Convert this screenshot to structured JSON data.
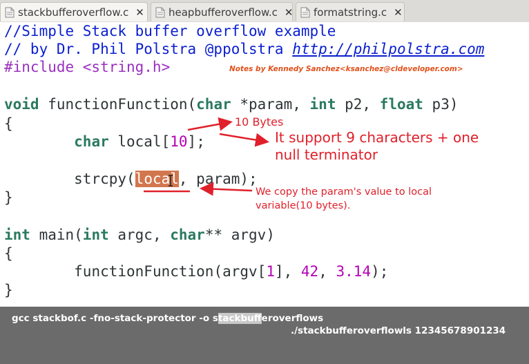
{
  "tabs": [
    {
      "label": "stackbufferoverflow.c",
      "close": "✕",
      "active": true
    },
    {
      "label": "heapbufferoverflow.c",
      "close": "✕",
      "active": false
    },
    {
      "label": "formatstring.c",
      "close": "✕",
      "active": false
    }
  ],
  "code": {
    "l1": "//Simple Stack buffer overflow example",
    "l2_prefix": "// by Dr. Phil Polstra @ppolstra ",
    "l2_url": "http://philpolstra.com",
    "l3": "#include <string.h>",
    "l5_kw1": "void",
    "l5_a": " functionFunction(",
    "l5_kw2": "char",
    "l5_b": " *param, ",
    "l5_kw3": "int",
    "l5_c": " p2, ",
    "l5_kw4": "float",
    "l5_d": " p3)",
    "l6": "{",
    "l7_indent": "        ",
    "l7_kw": "char",
    "l7_a": " local[",
    "l7_num": "10",
    "l7_b": "];",
    "l9_indent": "        ",
    "l9_a": "strcpy(",
    "l9_hl": "local",
    "l9_b": ", param);",
    "l10": "}",
    "l12_kw1": "int",
    "l12_a": " main(",
    "l12_kw2": "int",
    "l12_b": " argc, ",
    "l12_kw3": "char",
    "l12_c": "** argv)",
    "l13": "{",
    "l14_indent": "        ",
    "l14_a": "functionFunction(argv[",
    "l14_n1": "1",
    "l14_b": "], ",
    "l14_n2": "42",
    "l14_c": ", ",
    "l14_n3": "3.14",
    "l14_d": ");",
    "l15": "}"
  },
  "annotations": {
    "credit": "Notes by Kennedy Sanchez<ksanchez@cldeveloper.com>",
    "bytes": "10 Bytes",
    "support1": "It support 9 characters + one",
    "support2": "null terminator",
    "copy1": "We copy the param's value to local",
    "copy2": "variable(10 bytes)."
  },
  "terminal": {
    "cmd1_a": "gcc stackbof.c -fno-stack-protector -o s",
    "cmd1_sel": "tackbuff",
    "cmd1_b": "eroverflows",
    "cmd2": "./stackbufferoverflowls 12345678901234"
  },
  "colors": {
    "comment": "#0a1fd0",
    "keyword": "#2b7a5f",
    "preprocessor": "#9a2fbf",
    "number": "#b400b4",
    "annotation": "#e0202a",
    "highlight": "#d2764e",
    "terminal_bg": "#6b6b6b"
  }
}
